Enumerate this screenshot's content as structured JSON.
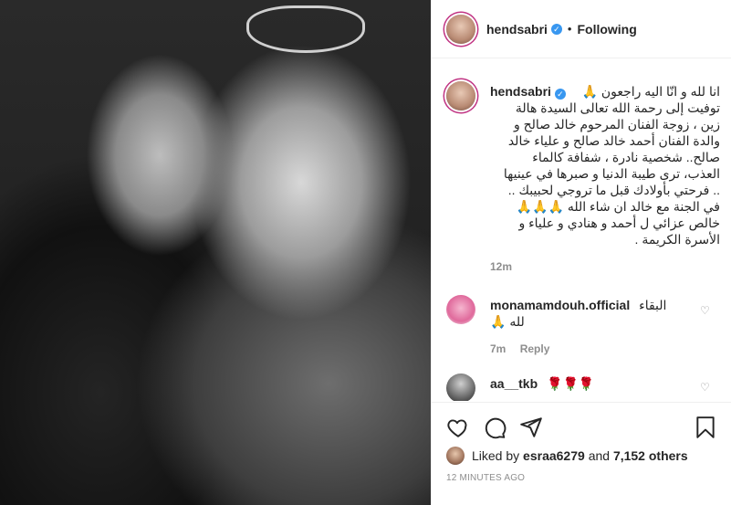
{
  "post": {
    "author": "hendsabri",
    "follow_status": "Following",
    "caption_lines": [
      "انا لله و انّا اليه راجعون 🙏",
      "توفيت إلى رحمة الله تعالى السيدة هالة",
      "زين ، زوجة الفنان المرحوم خالد صالح و",
      "والدة الفنان أحمد خالد صالح و علياء خالد",
      "صالح.. شخصية نادرة ، شفافة كالماء",
      "العذب، ترى طيبة الدنيا و صبرها في عينيها",
      ".. فرحتي بأولادك قبل ما تروجي لحبيبك ..",
      "في الجنة مع خالد ان شاء الله 🙏🙏🙏",
      "خالص عزائي ل أحمد و هنادي و علياء و",
      "الأسرة الكريمة ."
    ],
    "caption_time": "12m"
  },
  "comments": [
    {
      "user": "monamamdouh.official",
      "text_line1": "البقاء",
      "text_line2": "🙏 لله",
      "time": "7m",
      "reply": "Reply"
    },
    {
      "user": "aa__tkb",
      "text": "🌹🌹🌹"
    }
  ],
  "likes": {
    "prefix": "Liked by",
    "user": "esraa6279",
    "middle": "and",
    "others": "7,152 others"
  },
  "timestamp": "12 MINUTES AGO",
  "icons": {
    "verified": "verified-badge-icon",
    "heart": "heart-icon",
    "comment": "comment-icon",
    "share": "share-icon",
    "save": "bookmark-icon"
  }
}
